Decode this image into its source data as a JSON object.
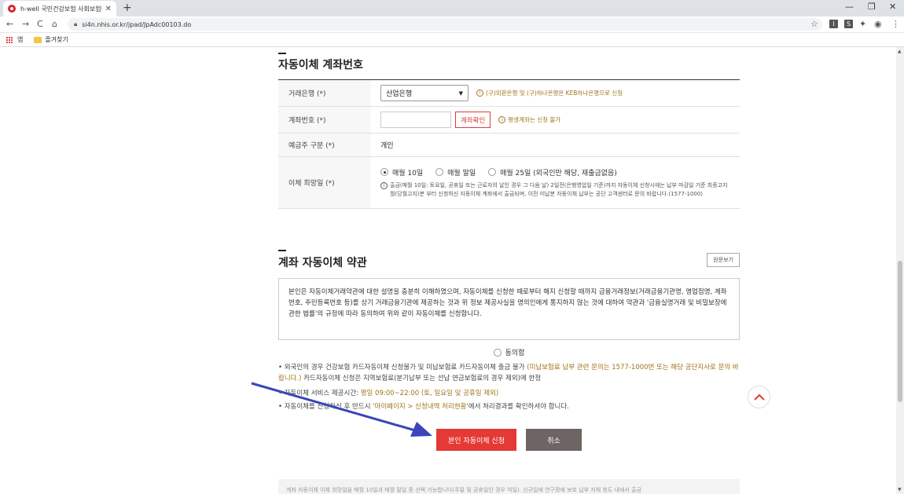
{
  "browser": {
    "tab_title": "h-well 국민건강보험 사회보험통",
    "tab_close": "✕",
    "new_tab": "+",
    "url": "si4n.nhis.or.kr/jpad/JpAdc00103.do",
    "minimize": "—",
    "restore": "❐",
    "close": "✕",
    "back": "←",
    "forward": "→",
    "reload": "C",
    "home": "⌂",
    "star": "☆",
    "menu": "⋮",
    "ext1": "I",
    "ext2": "S",
    "ext3": "✦",
    "profile": "◉"
  },
  "bookmarks": {
    "apps_label": "앱",
    "favorites_label": "즐겨찾기"
  },
  "section1": {
    "title": "자동이체 계좌번호",
    "bank_label": "거래은행 (*)",
    "bank_value": "산업은행",
    "bank_note": "(구)외환은행 및 (구)하나은행은 KEB하나은행으로 신청",
    "account_label": "계좌번호 (*)",
    "account_check": "계좌확인",
    "account_note": "평생계좌는 신청 불가",
    "holder_label": "예금주 구분 (*)",
    "holder_value": "개인",
    "date_label": "이체 희망일 (*)",
    "date_options": [
      "매월 10일",
      "매월 말일",
      "매월 25일 (외국인만 해당, 재출금없음)"
    ],
    "date_note": "출금(매월 10일: 토요일, 공휴일 또는 근로자의 날인 경우 그 다음 날) 2일전(은행영업일 기준)까지 자동이체 신청시에는 납부 마감일 기준 최종고지월(당월고지)분 부터 신청하신 자동이체 계좌에서 출금되며, 이전 미납분 자동이체 납부는 공단 고객센터로 문의 바랍니다.(1577-1000)"
  },
  "section2": {
    "title": "계좌 자동이체 약관",
    "original_btn": "원문보기",
    "terms_text": "본인은 자동이체거래약관에 대한 설명을 충분히 이해하였으며, 자동이체를 신청한 때로부터 해지 신청할 때까지 금융거래정보(거래금융기관명, 영업점명, 계좌번호, 주민등록번호 등)를 상기 거래금융기관에 제공하는 것과 위 정보 제공사실을 명의인에게 통지하지 않는 것에 대하여 약관과 '금융실명거래 및 비밀보장에 관한 법률'의 규정에 따라 동의하여 위와 같이 자동이체를 신청합니다.",
    "agree_label": "동의함"
  },
  "bullets": {
    "b1_pre": "외국인의 경우 건강보험 카드자동이체 신청불가 및 미납보험료 카드자동이체 출금 불가 ",
    "b1_hl": "(미납보험료 납부 관련 문의는 1577-1000번 또는 해당 공단지사로 문의 바랍니다.)",
    "b1_post": " 카드자동이체 신청은 지역보험료(분기납부 또는 선납 연금보험료의 경우 제외)에 한정",
    "b2_pre": "자동이체 서비스 제공시간: ",
    "b2_hl": "평일 09:00~22:00 (토, 일요일 및 공휴일 제외)",
    "b3_pre": "자동이체를 신청하신 후 반드시 ",
    "b3_hl": "'마이페이지 > 신청내역 처리현황'",
    "b3_post": "에서 처리결과를 확인하셔야 합니다."
  },
  "buttons": {
    "apply": "본인 자동이체 신청",
    "cancel": "취소"
  },
  "bottom_note": "계좌 자동이체 이체 희망일을 매월 10일과 매월 말일 중 선택 가능합니다(주말 및 공휴일인 경우 익일). 신규일에 연구정에 보호 납부 자체 청도 내에서 출금"
}
